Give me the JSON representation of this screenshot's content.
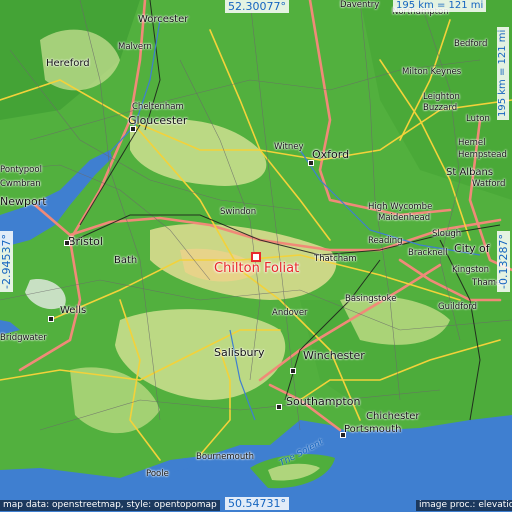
{
  "map": {
    "target_label": "Chilton Foliat",
    "lat_top": "52.30077°",
    "lat_bottom": "50.54731°",
    "lon_left": "-2.94537°",
    "lon_right": "-0.13287°",
    "scale_h": "195 km = 121 mi",
    "scale_v": "195 km = 121 mi",
    "credit_left": "map data: openstreetmap, style: opentopomap",
    "credit_right": "image proc.: elevation.city",
    "water_label": "The Solent",
    "colors": {
      "lowland": "#4fae3c",
      "hill": "#b9d983",
      "high": "#e6d58b",
      "sea": "#3f7fd0",
      "motorway": "#f08a78",
      "road": "#f3d23a",
      "target": "#e8282c",
      "coord_text": "#1565c0"
    },
    "places": [
      {
        "name": "Worcester"
      },
      {
        "name": "Daventry"
      },
      {
        "name": "Northampton"
      },
      {
        "name": "Malvern"
      },
      {
        "name": "Bedford"
      },
      {
        "name": "Hereford"
      },
      {
        "name": "Milton Keynes"
      },
      {
        "name": "Cheltenham"
      },
      {
        "name": "Leighton"
      },
      {
        "name": "Buzzard"
      },
      {
        "name": "Gloucester"
      },
      {
        "name": "Luton"
      },
      {
        "name": "Hemel"
      },
      {
        "name": "Hempstead"
      },
      {
        "name": "Witney"
      },
      {
        "name": "Oxford"
      },
      {
        "name": "Pontypool"
      },
      {
        "name": "Cwmbran"
      },
      {
        "name": "St Albans"
      },
      {
        "name": "Watford"
      },
      {
        "name": "Newport"
      },
      {
        "name": "Swindon"
      },
      {
        "name": "High Wycombe"
      },
      {
        "name": "Maidenhead"
      },
      {
        "name": "Bristol"
      },
      {
        "name": "Reading"
      },
      {
        "name": "Slough"
      },
      {
        "name": "City of"
      },
      {
        "name": "Bath"
      },
      {
        "name": "Thatcham"
      },
      {
        "name": "Bracknell"
      },
      {
        "name": "Kingston"
      },
      {
        "name": "Thames"
      },
      {
        "name": "Basingstoke"
      },
      {
        "name": "Wells"
      },
      {
        "name": "Andover"
      },
      {
        "name": "Guildford"
      },
      {
        "name": "Bridgwater"
      },
      {
        "name": "Salisbury"
      },
      {
        "name": "Winchester"
      },
      {
        "name": "Southampton"
      },
      {
        "name": "Chichester"
      },
      {
        "name": "Portsmouth"
      },
      {
        "name": "Bournemouth"
      },
      {
        "name": "Poole"
      }
    ]
  }
}
